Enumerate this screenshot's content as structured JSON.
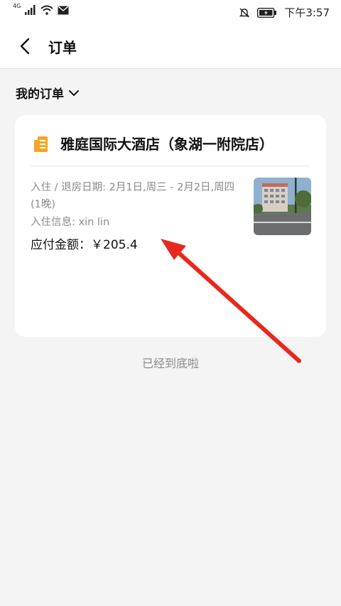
{
  "status_bar": {
    "network": "4G",
    "time": "下午3:57"
  },
  "header": {
    "title": "订单"
  },
  "section": {
    "title": "我的订单"
  },
  "order": {
    "hotel_name": "雅庭国际大酒店（象湖一附院店）",
    "stay_dates": "入住 / 退房日期: 2月1日,周三 - 2月2日,周四(1晚)",
    "guest_info": "入住信息: xin lin",
    "amount": "应付金额：￥205.4"
  },
  "footer": {
    "end_text": "已经到底啦"
  },
  "colors": {
    "accent_orange": "#f5a623",
    "annotation_arrow": "#e8281e"
  }
}
